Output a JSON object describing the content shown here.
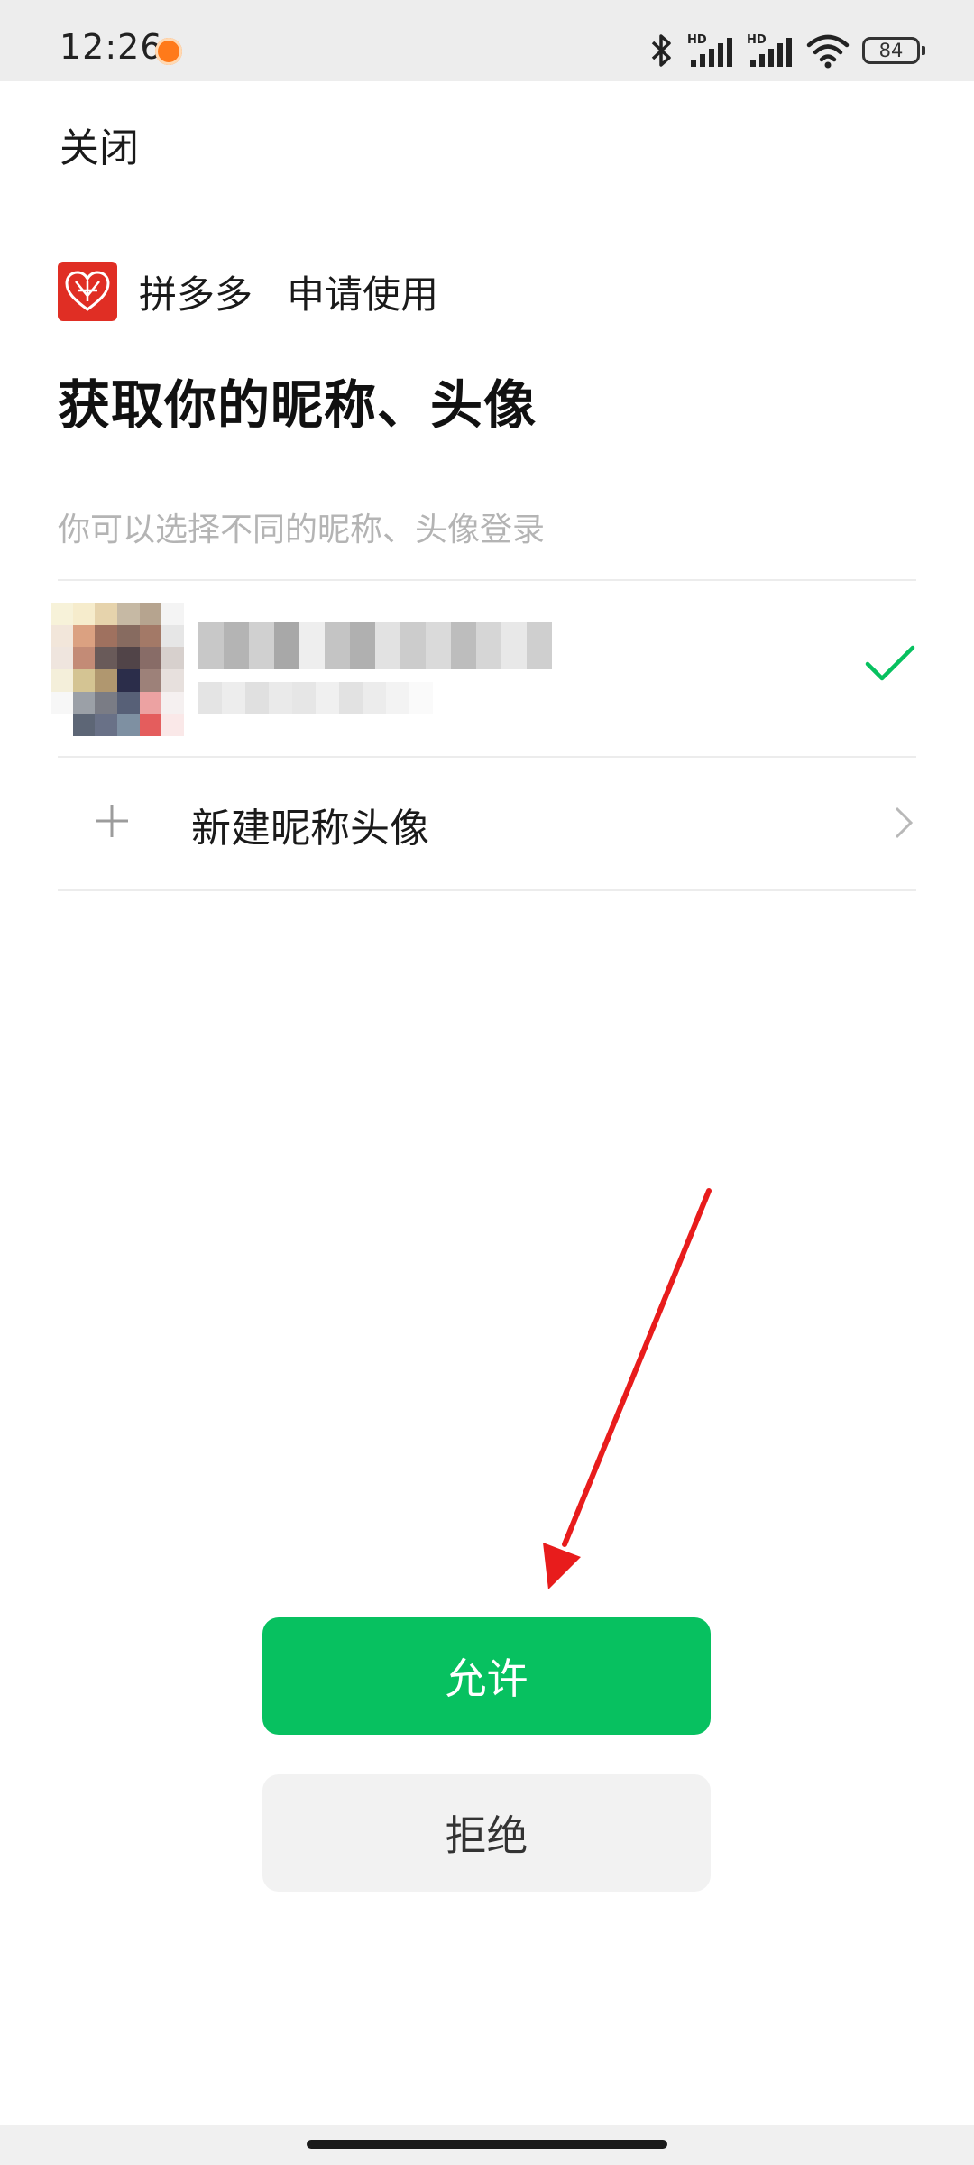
{
  "status_bar": {
    "time": "12:26",
    "battery": "84",
    "icons": [
      "orange-app-dot-icon",
      "bluetooth-icon",
      "hd-signal-icon",
      "hd-signal-icon",
      "wifi-icon",
      "battery-icon"
    ]
  },
  "header": {
    "close_label": "关闭"
  },
  "app": {
    "name": "拼多多",
    "request_text": "申请使用",
    "brand_color": "#e02e24"
  },
  "title": "获取你的昵称、头像",
  "hint": "你可以选择不同的昵称、头像登录",
  "profile": {
    "selected": true,
    "check_color": "#07c160"
  },
  "new_profile": {
    "label": "新建昵称头像"
  },
  "buttons": {
    "allow_label": "允许",
    "deny_label": "拒绝",
    "allow_color": "#07c160"
  },
  "annotation": {
    "arrow_color": "#e81c1c"
  }
}
